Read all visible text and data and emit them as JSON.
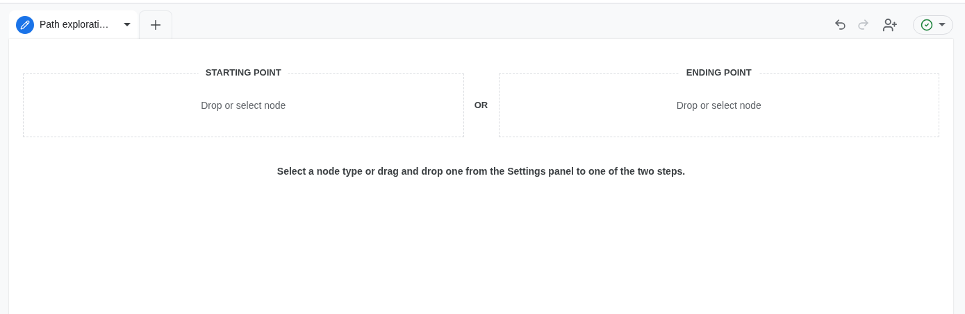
{
  "tabs": [
    {
      "label": "Path explorati…",
      "selected": true
    }
  ],
  "toolbar": {
    "undo": {
      "disabled": false
    },
    "redo": {
      "disabled": true
    }
  },
  "steps": [
    {
      "title": "STARTING POINT",
      "placeholder": "Drop or select node"
    },
    {
      "title": "ENDING POINT",
      "placeholder": "Drop or select node"
    }
  ],
  "separator": "OR",
  "hint": "Select a node type or drag and drop one from the Settings panel to one of the two steps."
}
